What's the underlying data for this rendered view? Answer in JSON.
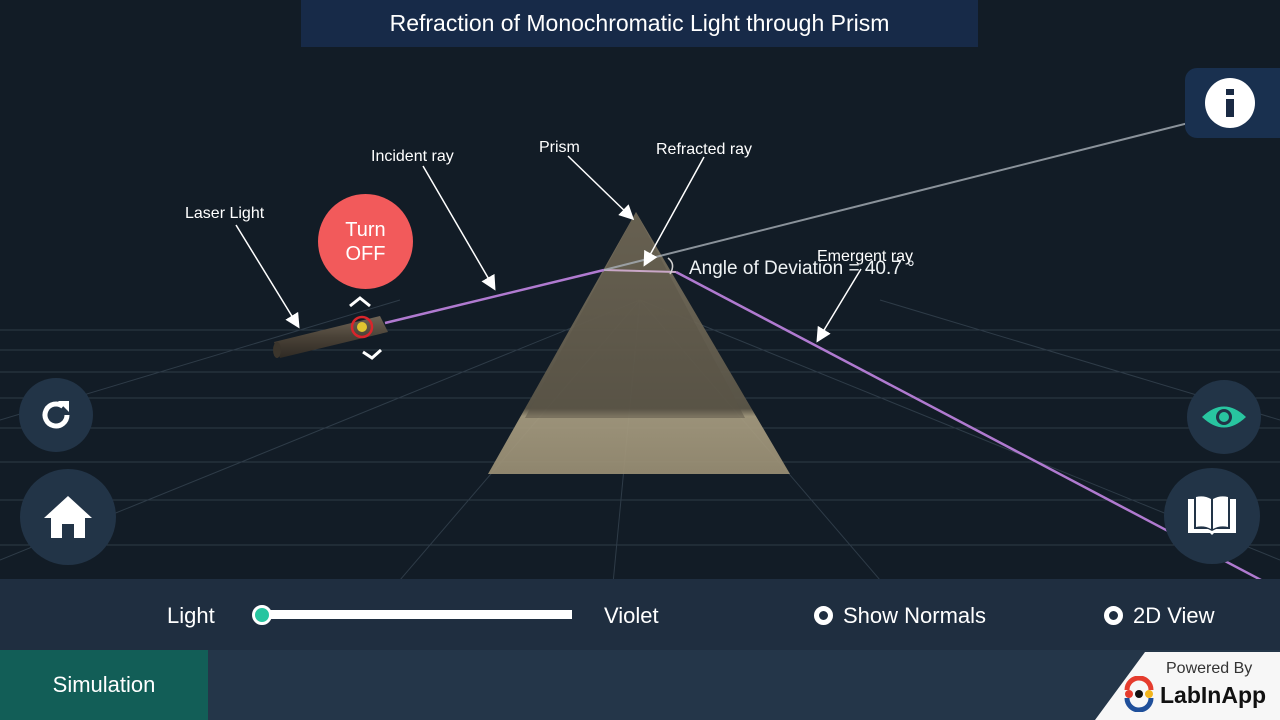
{
  "header": {
    "title": "Refraction of Monochromatic Light through Prism"
  },
  "icons": {
    "info": "info-icon",
    "reset": "refresh-icon",
    "home": "home-icon",
    "view": "eye-icon",
    "theory": "book-icon"
  },
  "scene": {
    "labels": {
      "laser": "Laser Light",
      "incident": "Incident ray",
      "prism": "Prism",
      "refracted": "Refracted ray",
      "emergent": "Emergent ray"
    },
    "turn_off_line1": "Turn",
    "turn_off_line2": "OFF",
    "deviation_text": "Angle of Deviation = 40.7 °",
    "deviation_value_deg": 40.7,
    "ray_color": "#b07ad0"
  },
  "controls": {
    "slider_left_label": "Light",
    "slider_right_label": "Violet",
    "slider_value_fraction": 0,
    "show_normals_label": "Show Normals",
    "show_normals_checked": false,
    "view_2d_label": "2D View",
    "view_2d_checked": false,
    "accent_color": "#28c5a0"
  },
  "footer": {
    "tab_label": "Simulation",
    "powered_by": "Powered By",
    "brand": "LabInApp"
  }
}
